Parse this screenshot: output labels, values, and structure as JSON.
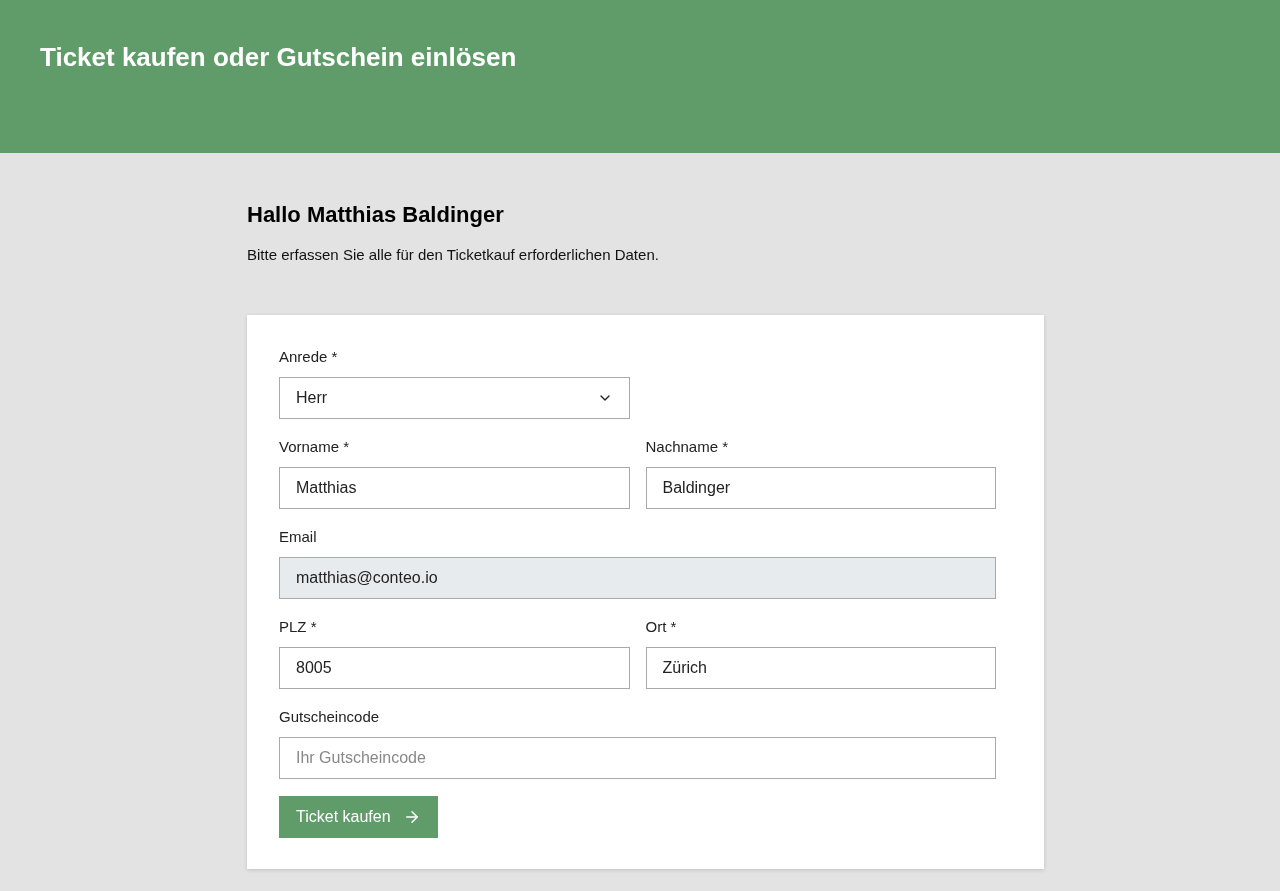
{
  "header": {
    "title": "Ticket kaufen oder Gutschein einlösen"
  },
  "greeting": "Hallo Matthias Baldinger",
  "intro": "Bitte erfassen Sie alle für den Ticketkauf erforderlichen Daten.",
  "form": {
    "rows": [
      {
        "fields": [
          {
            "kind": "select",
            "label": "Anrede *",
            "value": "Herr",
            "full_width": false
          }
        ]
      },
      {
        "fields": [
          {
            "kind": "text",
            "label": "Vorname *",
            "value": "Matthias",
            "disabled": false,
            "full_width": false
          },
          {
            "kind": "text",
            "label": "Nachname *",
            "value": "Baldinger",
            "disabled": false,
            "full_width": false
          }
        ]
      },
      {
        "fields": [
          {
            "kind": "text",
            "label": "Email",
            "value": "matthias@conteo.io",
            "disabled": true,
            "full_width": true
          }
        ]
      },
      {
        "fields": [
          {
            "kind": "text",
            "label": "PLZ *",
            "value": "8005",
            "disabled": false,
            "full_width": false
          },
          {
            "kind": "text",
            "label": "Ort *",
            "value": "Zürich",
            "disabled": false,
            "full_width": false
          }
        ]
      },
      {
        "fields": [
          {
            "kind": "text",
            "label": "Gutscheincode",
            "placeholder": "Ihr Gutscheincode",
            "disabled": false,
            "full_width": true
          }
        ]
      }
    ],
    "submit": {
      "label": "Ticket kaufen"
    }
  }
}
